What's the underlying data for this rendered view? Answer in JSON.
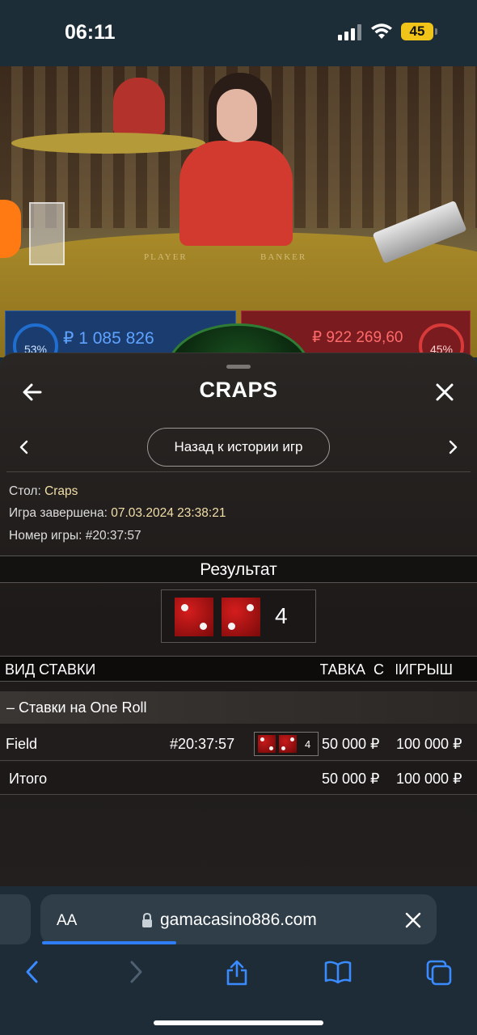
{
  "status_bar": {
    "time": "06:11",
    "battery": "45"
  },
  "video": {
    "player_label": "PLAYER",
    "banker_label": "BANKER"
  },
  "score_strip": {
    "left_percent": "53%",
    "left_amount": "₽ 1 085 826",
    "right_percent": "45%",
    "right_amount": "₽ 922 269,60",
    "left_color": "#1b3c6e",
    "right_color": "#7a1b1f"
  },
  "sheet": {
    "title": "CRAPS",
    "history_button": "Назад к истории игр",
    "table_label": "Стол:",
    "table_value": "Craps",
    "finished_label": "Игра завершена:",
    "finished_value": "07.03.2024 23:38:21",
    "game_number_label": "Номер игры:",
    "game_number_value": "#20:37:57",
    "result_label": "Результат",
    "result_dice": [
      2,
      2
    ],
    "result_sum": "4",
    "columns": {
      "bet_type": "ВИД СТАВКИ",
      "stake": "СТАВКА",
      "sep": "С",
      "win": "ВЫИГРЫШ"
    },
    "group_label": "– Ставки на One Roll",
    "bet": {
      "name": "Field",
      "game": "#20:37:57",
      "dice": [
        2,
        2
      ],
      "sum": "4",
      "stake": "50 000 ₽",
      "win": "100 000 ₽"
    },
    "total": {
      "label": "Итого",
      "stake": "50 000 ₽",
      "win": "100 000 ₽"
    }
  },
  "browser": {
    "aa_label": "AA",
    "url": "gamacasino886.com",
    "page_load_progress": 0.34,
    "accent_color": "#2f7ef5",
    "nav": [
      "back-icon",
      "forward-icon",
      "share-icon",
      "bookmarks-icon",
      "tabs-icon"
    ]
  }
}
